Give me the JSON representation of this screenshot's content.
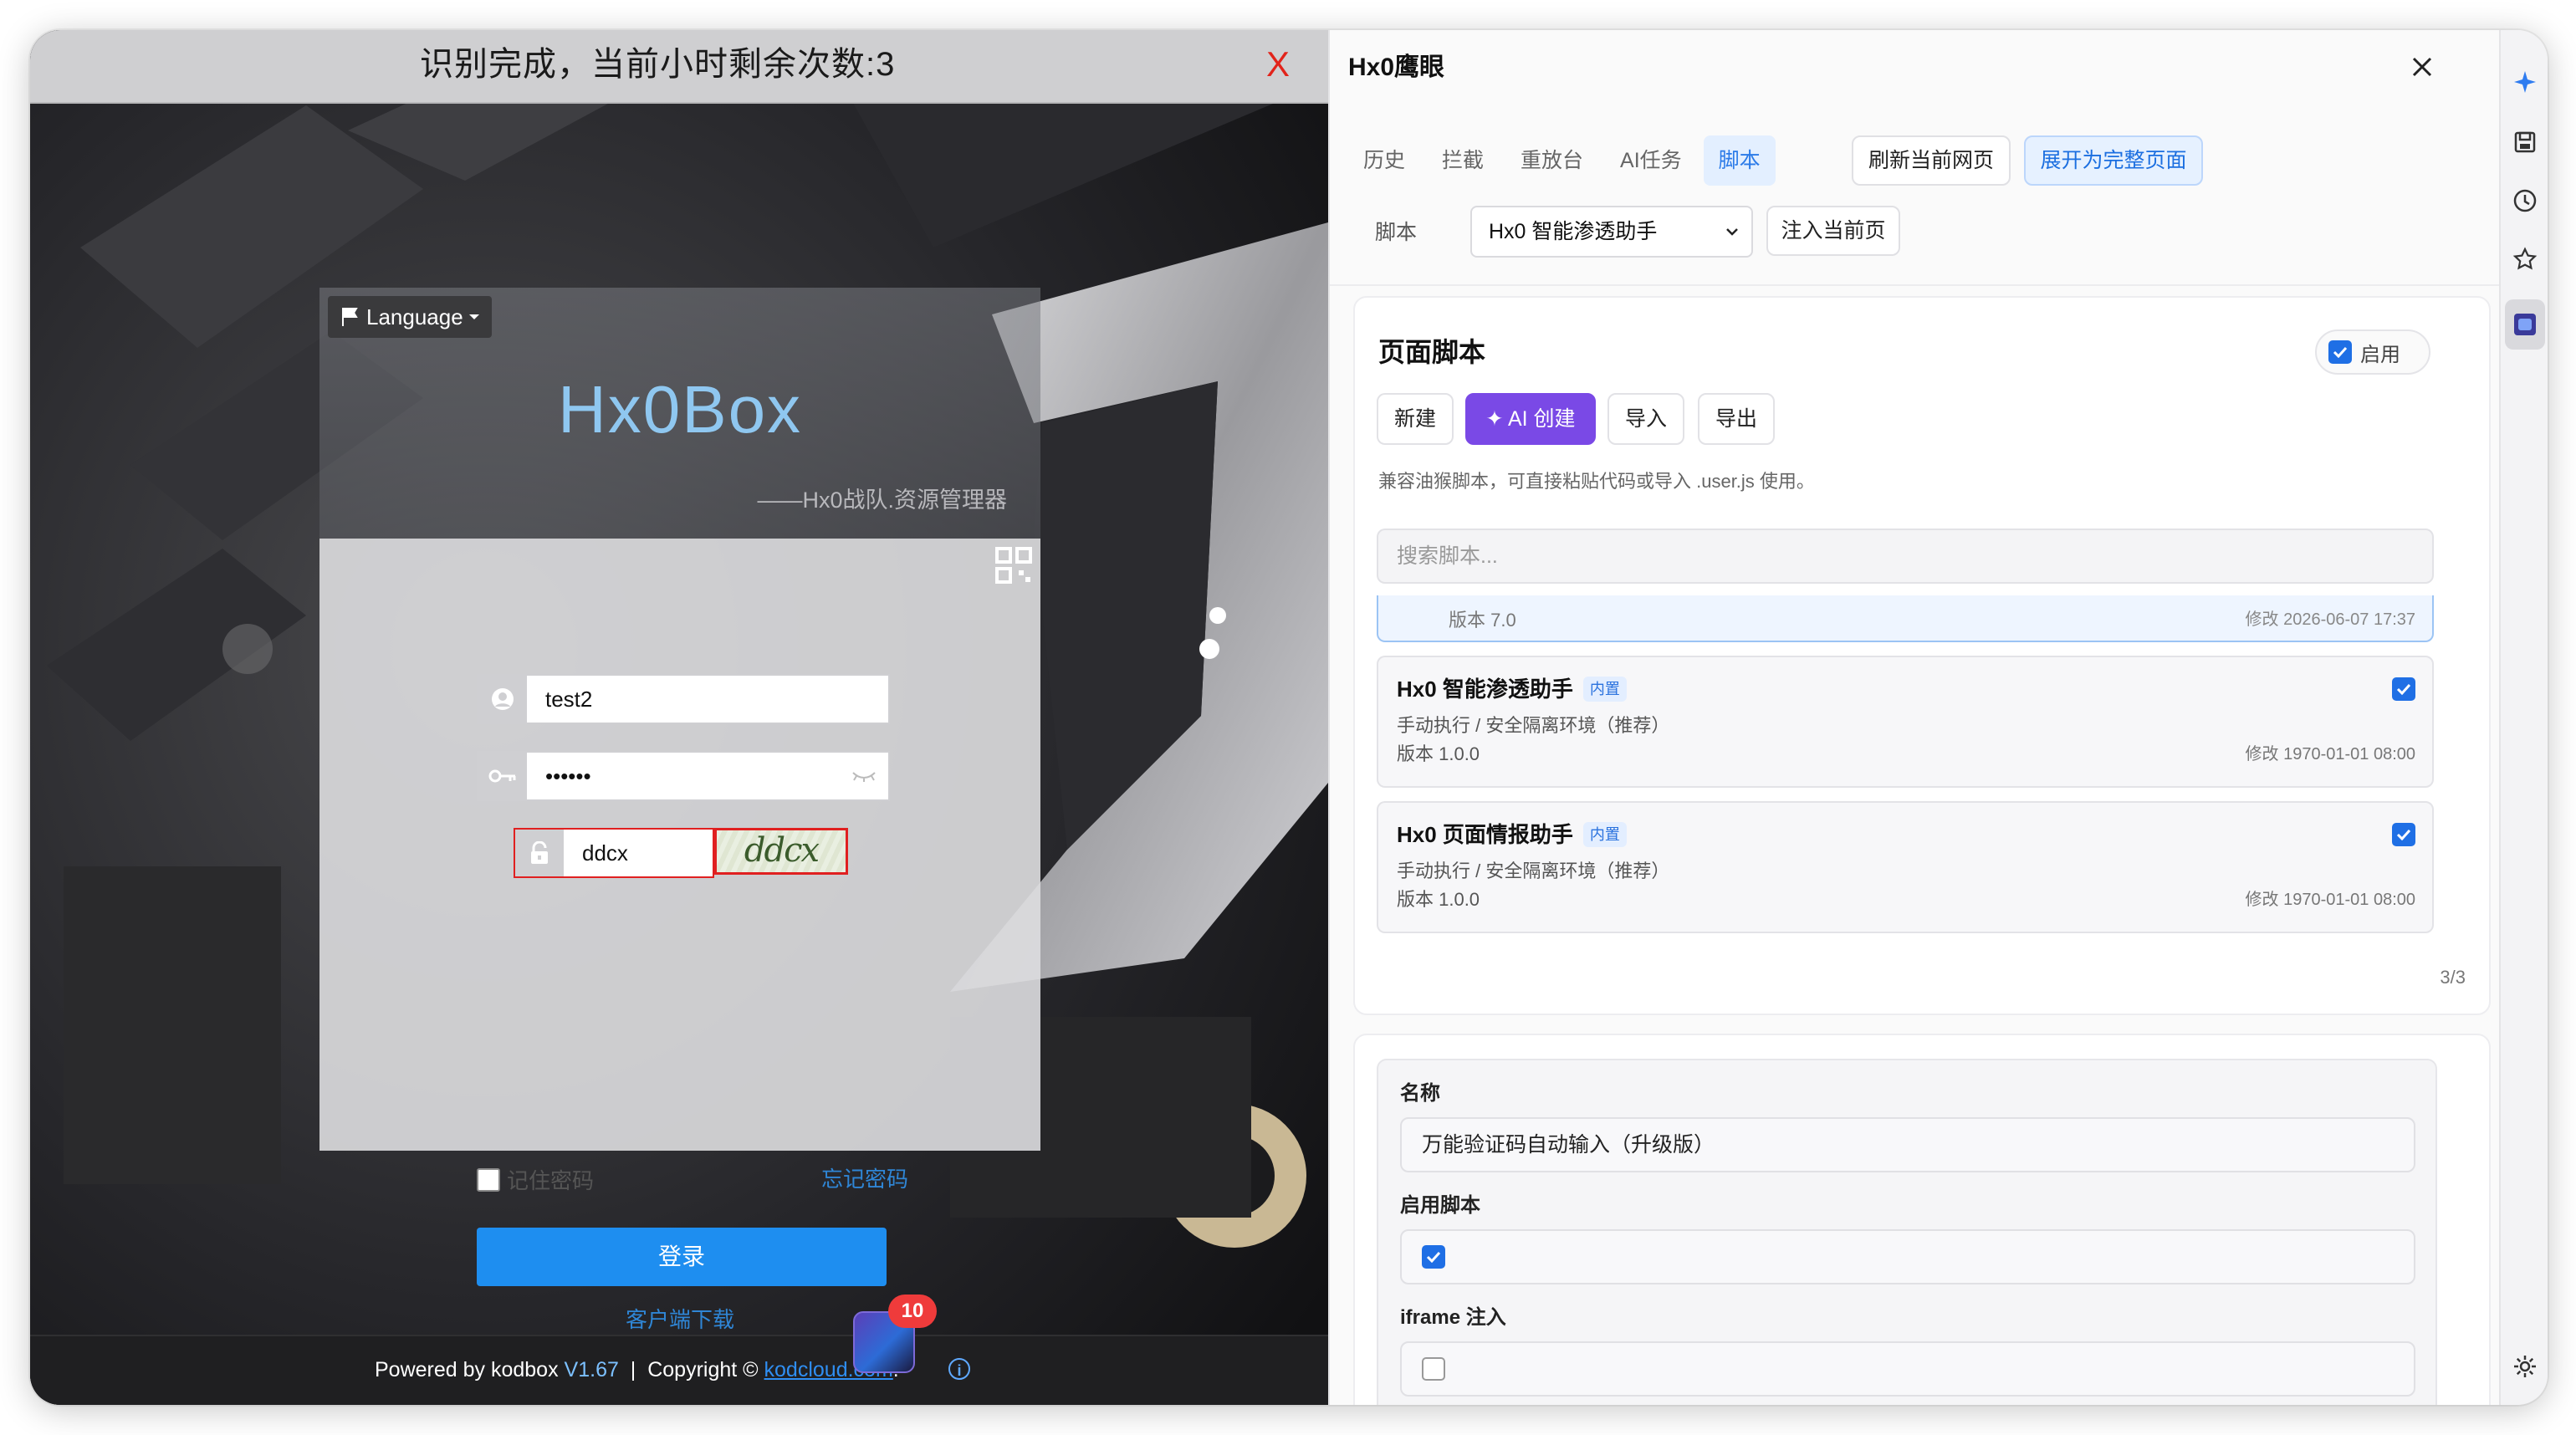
{
  "left_page": {
    "notice": {
      "text": "识别完成，当前小时剩余次数:3",
      "close": "X"
    },
    "login": {
      "language": "Language",
      "brand": "Hx0Box",
      "subtitle": "——Hx0战队.资源管理器",
      "username": "test2",
      "password_mask": "••••••",
      "captcha_input": "ddcx",
      "captcha_image_text": "ddcx",
      "remember_label": "记住密码",
      "forgot_label": "忘记密码",
      "login_button": "登录",
      "download_link": "客户端下载"
    },
    "footer": {
      "powered": "Powered by kodbox",
      "version": "V1.67",
      "separator": "|",
      "copyright": "Copyright ©",
      "link": "kodcloud.com",
      "dot": "."
    },
    "floating_badge": "10"
  },
  "panel": {
    "title": "Hx0鹰眼",
    "tabs": [
      {
        "label": "历史",
        "active": false
      },
      {
        "label": "拦截",
        "active": false
      },
      {
        "label": "重放台",
        "active": false
      },
      {
        "label": "AI任务",
        "active": false
      },
      {
        "label": "脚本",
        "active": true
      }
    ],
    "refresh_button": "刷新当前网页",
    "expand_button": "展开为完整页面",
    "script_label": "脚本",
    "script_select": "Hx0 智能渗透助手",
    "inject_button": "注入当前页",
    "page_scripts": {
      "title": "页面脚本",
      "enabled_label": "启用",
      "new_button": "新建",
      "ai_button": "AI 创建",
      "import_button": "导入",
      "export_button": "导出",
      "hint": "兼容油猴脚本，可直接粘贴代码或导入 .user.js 使用。",
      "search_placeholder": "搜索脚本...",
      "partial_item": {
        "version": "版本 7.0",
        "modified": "修改 2026-06-07 17:37"
      },
      "items": [
        {
          "name": "Hx0 智能渗透助手",
          "tag": "内置",
          "desc": "手动执行 / 安全隔离环境（推荐）",
          "version": "版本 1.0.0",
          "modified": "修改 1970-01-01 08:00",
          "checked": true
        },
        {
          "name": "Hx0 页面情报助手",
          "tag": "内置",
          "desc": "手动执行 / 安全隔离环境（推荐）",
          "version": "版本 1.0.0",
          "modified": "修改 1970-01-01 08:00",
          "checked": true
        }
      ],
      "count": "3/3"
    },
    "editor": {
      "name_label": "名称",
      "name_value": "万能验证码自动输入（升级版）",
      "enable_label": "启用脚本",
      "enable_checked": true,
      "iframe_label": "iframe 注入",
      "iframe_checked": false
    }
  },
  "colors": {
    "accent": "#1f6fe5",
    "ai_purple": "#7a49e6",
    "notice_close_red": "#e2231a",
    "login_blue": "#1e8ef0",
    "badge_red": "#ef3b3b"
  },
  "rail_icons": [
    "sparkle-icon",
    "save-icon",
    "clock-icon",
    "star-icon",
    "extension-avatar-icon",
    "settings-icon"
  ]
}
